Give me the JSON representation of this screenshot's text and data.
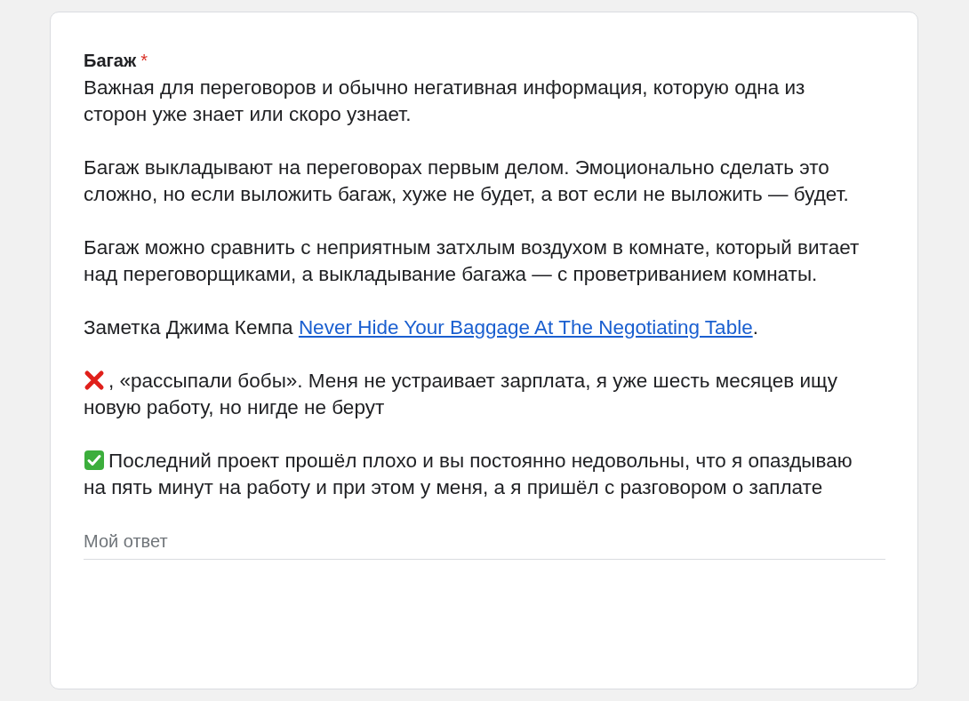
{
  "question": {
    "title": "Багаж",
    "required_mark": "*",
    "paragraphs": [
      {
        "kind": "plain",
        "text": "Важная для переговоров и обычно негативная информация, которую одна из сторон уже знает или скоро узнает."
      },
      {
        "kind": "plain",
        "text": "Багаж выкладывают на переговорах первым делом. Эмоционально сделать это сложно, но если выложить багаж, хуже не будет, а вот если не выложить — будет."
      },
      {
        "kind": "plain",
        "text": "Багаж можно сравнить с неприятным затхлым воздухом в комнате, который витает над переговорщиками, а выкладывание багажа — с проветриванием комнаты."
      },
      {
        "kind": "link",
        "text": "Заметка Джима Кемпа ",
        "link": "Never Hide Your Baggage At The Negotiating Table",
        "after": "."
      },
      {
        "kind": "bad",
        "text": ", «рассыпали бобы». Меня не устраивает зарплата, я уже шесть месяцев ищу новую работу, но нигде не берут"
      },
      {
        "kind": "good",
        "text": "Последний проект прошёл плохо и вы постоянно недовольны, что я опаздываю на пять минут на работу и при этом у меня, а я пришёл с разговором о заплате"
      }
    ],
    "answer": {
      "placeholder": "Мой ответ"
    }
  }
}
